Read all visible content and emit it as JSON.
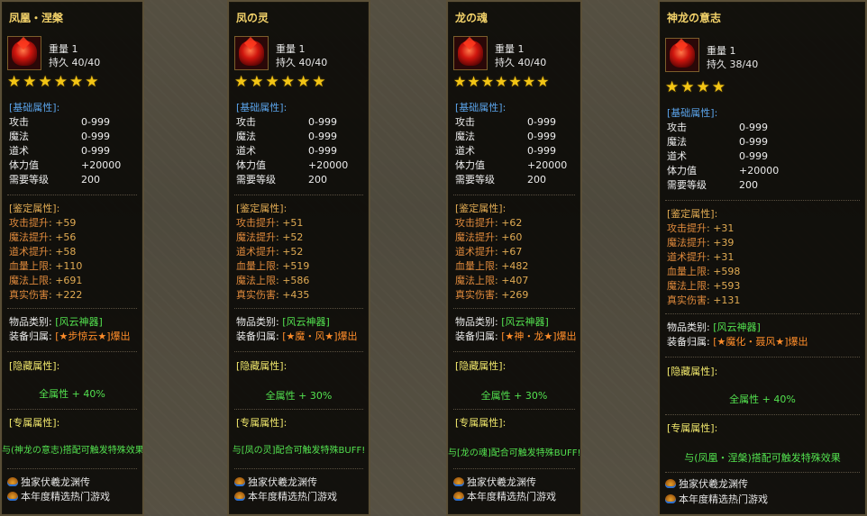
{
  "panels": [
    {
      "title": "凤凰・涅槃",
      "weight": "重量 1",
      "durability": "持久 40/40",
      "stars": "★★★★★★",
      "base_header": "[基础属性]:",
      "base": [
        {
          "k": "攻击",
          "v": "0-999"
        },
        {
          "k": "魔法",
          "v": "0-999"
        },
        {
          "k": "道术",
          "v": "0-999"
        },
        {
          "k": "体力值",
          "v": "+20000"
        },
        {
          "k": "需要等级",
          "v": "200"
        }
      ],
      "id_header": "[鉴定属性]:",
      "id": [
        {
          "k": "攻击提升",
          "v": ": +59"
        },
        {
          "k": "魔法提升",
          "v": ": +56"
        },
        {
          "k": "道术提升",
          "v": ": +58"
        },
        {
          "k": "血量上限",
          "v": ": +110"
        },
        {
          "k": "魔法上限",
          "v": ": +691"
        },
        {
          "k": "真实伤害",
          "v": ": +222"
        }
      ],
      "category_label": "物品类别:",
      "category_value": "[风云神器]",
      "owner_label": "装备归属:",
      "owner_value": "[★步惊云★]爆出",
      "hidden_header": "[隐藏属性]:",
      "hidden_value": "全属性 + 40%",
      "exclusive_header": "[专属属性]:",
      "exclusive_value": "与(神龙の意志)搭配可触发特殊效果",
      "footer1": "独家伏羲龙渊传",
      "footer2": "本年度精选热门游戏"
    },
    {
      "title": "凤の灵",
      "weight": "重量 1",
      "durability": "持久 40/40",
      "stars": "★★★★★★",
      "base_header": "[基础属性]:",
      "base": [
        {
          "k": "攻击",
          "v": "0-999"
        },
        {
          "k": "魔法",
          "v": "0-999"
        },
        {
          "k": "道术",
          "v": "0-999"
        },
        {
          "k": "体力值",
          "v": "+20000"
        },
        {
          "k": "需要等级",
          "v": "200"
        }
      ],
      "id_header": "[鉴定属性]:",
      "id": [
        {
          "k": "攻击提升",
          "v": ": +51"
        },
        {
          "k": "魔法提升",
          "v": ": +52"
        },
        {
          "k": "道术提升",
          "v": ": +52"
        },
        {
          "k": "血量上限",
          "v": ": +519"
        },
        {
          "k": "魔法上限",
          "v": ": +586"
        },
        {
          "k": "真实伤害",
          "v": ": +435"
        }
      ],
      "category_label": "物品类别:",
      "category_value": "[风云神器]",
      "owner_label": "装备归属:",
      "owner_value": "[★魔・风★]爆出",
      "hidden_header": "[隐藏属性]:",
      "hidden_value": "全属性 + 30%",
      "exclusive_header": "[专属属性]:",
      "exclusive_value": "与[凤の灵]配合可触发特殊BUFF!",
      "footer1": "独家伏羲龙渊传",
      "footer2": "本年度精选热门游戏"
    },
    {
      "title": "龙の魂",
      "weight": "重量 1",
      "durability": "持久 40/40",
      "stars": "★★★★★★★",
      "base_header": "[基础属性]:",
      "base": [
        {
          "k": "攻击",
          "v": "0-999"
        },
        {
          "k": "魔法",
          "v": "0-999"
        },
        {
          "k": "道术",
          "v": "0-999"
        },
        {
          "k": "体力值",
          "v": "+20000"
        },
        {
          "k": "需要等级",
          "v": "200"
        }
      ],
      "id_header": "[鉴定属性]:",
      "id": [
        {
          "k": "攻击提升",
          "v": ": +62"
        },
        {
          "k": "魔法提升",
          "v": ": +60"
        },
        {
          "k": "道术提升",
          "v": ": +67"
        },
        {
          "k": "血量上限",
          "v": ": +482"
        },
        {
          "k": "魔法上限",
          "v": ": +407"
        },
        {
          "k": "真实伤害",
          "v": ": +269"
        }
      ],
      "category_label": "物品类别:",
      "category_value": "[风云神器]",
      "owner_label": "装备归属:",
      "owner_value": "[★神・龙★]爆出",
      "hidden_header": "[隐藏属性]:",
      "hidden_value": "全属性 + 30%",
      "exclusive_header": "[专属属性]:",
      "exclusive_value": "与[龙の魂]配合可触发特殊BUFF!",
      "footer1": "独家伏羲龙渊传",
      "footer2": "本年度精选热门游戏"
    },
    {
      "title": "神龙の意志",
      "weight": "重量 1",
      "durability": "持久 38/40",
      "stars": "★★★★",
      "base_header": "[基础属性]:",
      "base": [
        {
          "k": "攻击",
          "v": "0-999"
        },
        {
          "k": "魔法",
          "v": "0-999"
        },
        {
          "k": "道术",
          "v": "0-999"
        },
        {
          "k": "体力值",
          "v": "+20000"
        },
        {
          "k": "需要等级",
          "v": "200"
        }
      ],
      "id_header": "[鉴定属性]:",
      "id": [
        {
          "k": "攻击提升",
          "v": ": +31"
        },
        {
          "k": "魔法提升",
          "v": ": +39"
        },
        {
          "k": "道术提升",
          "v": ": +31"
        },
        {
          "k": "血量上限",
          "v": ": +598"
        },
        {
          "k": "魔法上限",
          "v": ": +593"
        },
        {
          "k": "真实伤害",
          "v": ": +131"
        }
      ],
      "category_label": "物品类别:",
      "category_value": "[风云神器]",
      "owner_label": "装备归属:",
      "owner_value": "[★魔化・聂风★]爆出",
      "hidden_header": "[隐藏属性]:",
      "hidden_value": "全属性 + 40%",
      "exclusive_header": "[专属属性]:",
      "exclusive_value": "与(凤凰・涅槃)搭配可触发特殊效果",
      "footer1": "独家伏羲龙渊传",
      "footer2": "本年度精选热门游戏"
    }
  ]
}
